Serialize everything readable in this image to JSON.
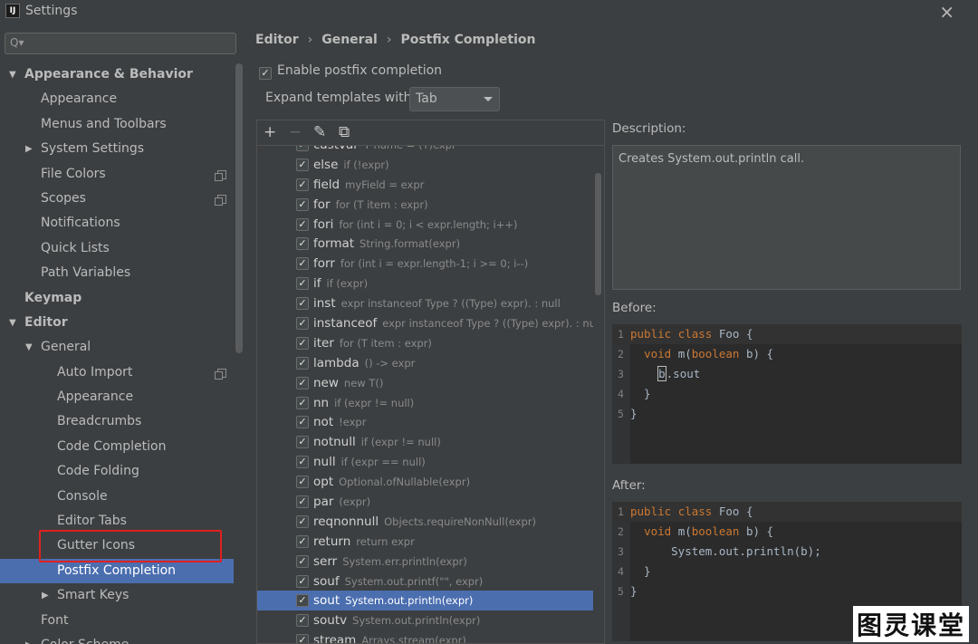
{
  "window": {
    "title": "Settings",
    "app_icon": "IJ",
    "close_glyph": "×"
  },
  "sidebar": {
    "search": {
      "placeholder": "",
      "value": ""
    },
    "items": [
      {
        "label": "Appearance & Behavior",
        "level": 0,
        "bold": true,
        "arrow": "▼"
      },
      {
        "label": "Appearance",
        "level": 1
      },
      {
        "label": "Menus and Toolbars",
        "level": 1
      },
      {
        "label": "System Settings",
        "level": 1,
        "arrow": "▶"
      },
      {
        "label": "File Colors",
        "level": 1,
        "copy_icon": true
      },
      {
        "label": "Scopes",
        "level": 1,
        "copy_icon": true
      },
      {
        "label": "Notifications",
        "level": 1
      },
      {
        "label": "Quick Lists",
        "level": 1
      },
      {
        "label": "Path Variables",
        "level": 1
      },
      {
        "label": "Keymap",
        "level": 0,
        "bold": true
      },
      {
        "label": "Editor",
        "level": 0,
        "bold": true,
        "arrow": "▼"
      },
      {
        "label": "General",
        "level": 1,
        "arrow": "▼"
      },
      {
        "label": "Auto Import",
        "level": 2,
        "copy_icon": true
      },
      {
        "label": "Appearance",
        "level": 2
      },
      {
        "label": "Breadcrumbs",
        "level": 2
      },
      {
        "label": "Code Completion",
        "level": 2
      },
      {
        "label": "Code Folding",
        "level": 2
      },
      {
        "label": "Console",
        "level": 2
      },
      {
        "label": "Editor Tabs",
        "level": 2
      },
      {
        "label": "Gutter Icons",
        "level": 2
      },
      {
        "label": "Postfix Completion",
        "level": 2,
        "selected": true
      },
      {
        "label": "Smart Keys",
        "level": 2,
        "arrow": "▶"
      },
      {
        "label": "Font",
        "level": 1
      },
      {
        "label": "Color Scheme",
        "level": 1,
        "arrow": "▶"
      }
    ]
  },
  "breadcrumb": [
    "Editor",
    "General",
    "Postfix Completion"
  ],
  "breadcrumb_sep": "›",
  "enable_postfix": {
    "label": "Enable postfix completion",
    "checked": true
  },
  "expand": {
    "label": "Expand templates with",
    "value": "Tab"
  },
  "toolbar": {
    "add": "+",
    "remove": "−",
    "edit": "✎",
    "copy": "⧉"
  },
  "templates": [
    {
      "name": "castvar",
      "desc": "T name = (T)expr"
    },
    {
      "name": "else",
      "desc": "if (!expr)"
    },
    {
      "name": "field",
      "desc": "myField = expr"
    },
    {
      "name": "for",
      "desc": "for (T item : expr)"
    },
    {
      "name": "fori",
      "desc": "for (int i = 0; i < expr.length; i++)"
    },
    {
      "name": "format",
      "desc": "String.format(expr)"
    },
    {
      "name": "forr",
      "desc": "for (int i = expr.length-1; i >= 0; i--)"
    },
    {
      "name": "if",
      "desc": "if (expr)"
    },
    {
      "name": "inst",
      "desc": "expr instanceof Type ? ((Type) expr). : null"
    },
    {
      "name": "instanceof",
      "desc": "expr instanceof Type ? ((Type) expr). : nu"
    },
    {
      "name": "iter",
      "desc": "for (T item : expr)"
    },
    {
      "name": "lambda",
      "desc": "() -> expr"
    },
    {
      "name": "new",
      "desc": "new T()"
    },
    {
      "name": "nn",
      "desc": "if (expr != null)"
    },
    {
      "name": "not",
      "desc": "!expr"
    },
    {
      "name": "notnull",
      "desc": "if (expr != null)"
    },
    {
      "name": "null",
      "desc": "if (expr == null)"
    },
    {
      "name": "opt",
      "desc": "Optional.ofNullable(expr)"
    },
    {
      "name": "par",
      "desc": "(expr)"
    },
    {
      "name": "reqnonnull",
      "desc": "Objects.requireNonNull(expr)"
    },
    {
      "name": "return",
      "desc": "return expr"
    },
    {
      "name": "serr",
      "desc": "System.err.println(expr)"
    },
    {
      "name": "souf",
      "desc": "System.out.printf(\"\", expr)"
    },
    {
      "name": "sout",
      "desc": "System.out.println(expr)",
      "selected": true
    },
    {
      "name": "soutv",
      "desc": "System.out.println(expr)"
    },
    {
      "name": "stream",
      "desc": "Arrays.stream(expr)"
    }
  ],
  "check_glyph": "✓",
  "description": {
    "label": "Description:",
    "text": "Creates System.out.println call."
  },
  "before": {
    "label": "Before:",
    "lines": [
      {
        "n": "1",
        "kw1": "public",
        "kw2": "class",
        "rest": " Foo {"
      },
      {
        "n": "2",
        "pre": "  ",
        "kw1": "void",
        "mid": " m(",
        "kw2": "boolean",
        "rest": " b) {"
      },
      {
        "n": "3",
        "pre": "    ",
        "cursor": "b",
        "rest": ".sout"
      },
      {
        "n": "4",
        "rest": "  }"
      },
      {
        "n": "5",
        "rest": "}"
      }
    ]
  },
  "after": {
    "label": "After:",
    "lines": [
      {
        "n": "1",
        "kw1": "public",
        "kw2": "class",
        "rest": " Foo {"
      },
      {
        "n": "2",
        "pre": "  ",
        "kw1": "void",
        "mid": " m(",
        "kw2": "boolean",
        "rest": " b) {"
      },
      {
        "n": "3",
        "pre": "      ",
        "rest": "System.out.println(b);"
      },
      {
        "n": "4",
        "rest": "  }"
      },
      {
        "n": "5",
        "rest": "}"
      }
    ]
  },
  "watermark": "图灵课堂",
  "colors": {
    "selection": "#4b6eaf",
    "keyword": "#cc7832",
    "highlight_box": "#e02020"
  }
}
